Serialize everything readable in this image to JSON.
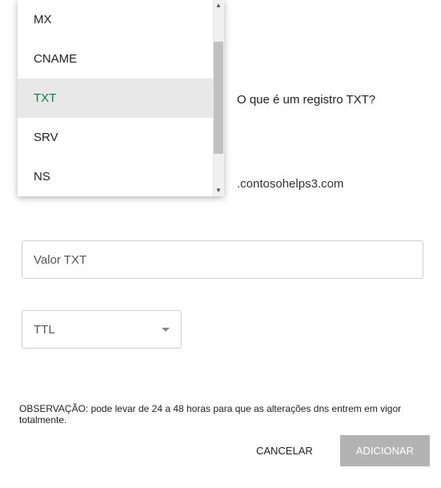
{
  "dropdown": {
    "items": [
      {
        "label": "MX"
      },
      {
        "label": "CNAME"
      },
      {
        "label": "TXT"
      },
      {
        "label": "SRV"
      },
      {
        "label": "NS"
      }
    ]
  },
  "help_link": "O que é um registro TXT?",
  "domain_suffix": ".contosohelps3.com",
  "txt_placeholder": "Valor TXT",
  "ttl_label": "TTL",
  "note_text": "OBSERVAÇÃO: pode levar de 24 a 48 horas para que as alterações dns entrem em vigor totalmente.",
  "buttons": {
    "cancel": "CANCELAR",
    "add": "ADICIONAR"
  }
}
